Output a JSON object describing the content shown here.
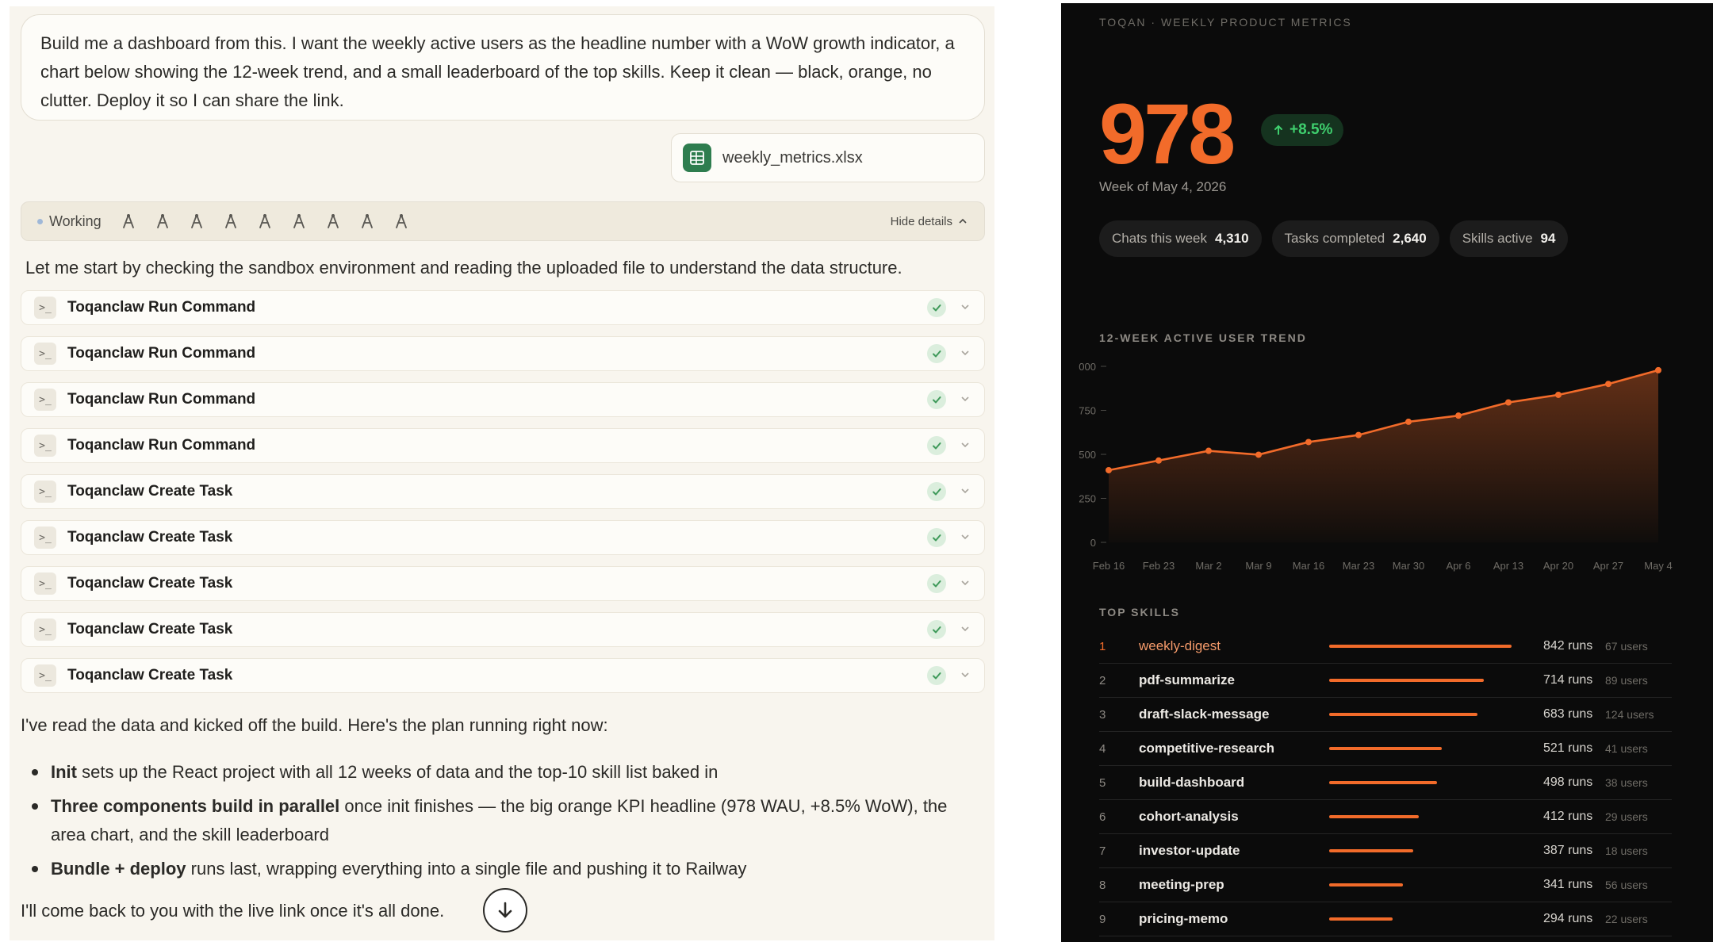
{
  "chat": {
    "prompt": "Build me a dashboard from this. I want the weekly active users as the headline number with a WoW growth indicator, a chart below showing the 12-week trend, and a small leaderboard of the top skills. Keep it clean — black, orange, no clutter. Deploy it so I can share the link.",
    "attachment": {
      "filename": "weekly_metrics.xlsx",
      "icon": "spreadsheet-icon"
    },
    "working": {
      "status": "Working",
      "hide_details": "Hide details",
      "tool_icon_count": 9
    },
    "intro": "Let me start by checking the sandbox environment and reading the uploaded file to understand the data structure.",
    "tool_calls": [
      {
        "label": "Toqanclaw Run Command",
        "status": "done"
      },
      {
        "label": "Toqanclaw Run Command",
        "status": "done"
      },
      {
        "label": "Toqanclaw Run Command",
        "status": "done"
      },
      {
        "label": "Toqanclaw Run Command",
        "status": "done"
      },
      {
        "label": "Toqanclaw Create Task",
        "status": "done"
      },
      {
        "label": "Toqanclaw Create Task",
        "status": "done"
      },
      {
        "label": "Toqanclaw Create Task",
        "status": "done"
      },
      {
        "label": "Toqanclaw Create Task",
        "status": "done"
      },
      {
        "label": "Toqanclaw Create Task",
        "status": "done"
      }
    ],
    "plan_intro": "I've read the data and kicked off the build. Here's the plan running right now:",
    "plan": [
      {
        "bold": "Init",
        "rest": " sets up the React project with all 12 weeks of data and the top-10 skill list baked in"
      },
      {
        "bold": "Three components build in parallel",
        "rest": " once init finishes — the big orange KPI headline (978 WAU, +8.5% WoW), the area chart, and the skill leaderboard"
      },
      {
        "bold": "Bundle + deploy",
        "rest": " runs last, wrapping everything into a single file and pushing it to Railway"
      }
    ],
    "closing": "I'll come back to you with the live link once it's all done."
  },
  "dashboard": {
    "brand": "TOQAN · WEEKLY PRODUCT METRICS",
    "kpi": "978",
    "growth": "+8.5%",
    "week": "Week of May 4, 2026",
    "stats": [
      {
        "label": "Chats this week",
        "value": "4,310"
      },
      {
        "label": "Tasks completed",
        "value": "2,640"
      },
      {
        "label": "Skills active",
        "value": "94"
      }
    ],
    "trend_title": "12-WEEK ACTIVE USER TREND",
    "skills_title": "TOP SKILLS",
    "colors": {
      "accent": "#f26b2a",
      "background": "#0b0b0b",
      "growth": "#3fcf6e"
    },
    "skills": [
      {
        "rank": "1",
        "name": "weekly-digest",
        "runs_label": "842 runs",
        "users_label": "67 users",
        "runs": 842
      },
      {
        "rank": "2",
        "name": "pdf-summarize",
        "runs_label": "714 runs",
        "users_label": "89 users",
        "runs": 714
      },
      {
        "rank": "3",
        "name": "draft-slack-message",
        "runs_label": "683 runs",
        "users_label": "124 users",
        "runs": 683
      },
      {
        "rank": "4",
        "name": "competitive-research",
        "runs_label": "521 runs",
        "users_label": "41 users",
        "runs": 521
      },
      {
        "rank": "5",
        "name": "build-dashboard",
        "runs_label": "498 runs",
        "users_label": "38 users",
        "runs": 498
      },
      {
        "rank": "6",
        "name": "cohort-analysis",
        "runs_label": "412 runs",
        "users_label": "29 users",
        "runs": 412
      },
      {
        "rank": "7",
        "name": "investor-update",
        "runs_label": "387 runs",
        "users_label": "18 users",
        "runs": 387
      },
      {
        "rank": "8",
        "name": "meeting-prep",
        "runs_label": "341 runs",
        "users_label": "56 users",
        "runs": 341
      },
      {
        "rank": "9",
        "name": "pricing-memo",
        "runs_label": "294 runs",
        "users_label": "22 users",
        "runs": 294
      }
    ]
  },
  "chart_data": {
    "type": "area",
    "title": "12-WEEK ACTIVE USER TREND",
    "categories": [
      "Feb 16",
      "Feb 23",
      "Mar 2",
      "Mar 9",
      "Mar 16",
      "Mar 23",
      "Mar 30",
      "Apr 6",
      "Apr 13",
      "Apr 20",
      "Apr 27",
      "May 4"
    ],
    "series": [
      {
        "values": [
          410,
          465,
          520,
          498,
          570,
          610,
          685,
          720,
          795,
          838,
          900,
          978
        ]
      }
    ],
    "y_ticks": [
      "000",
      "750",
      "500",
      "250",
      "0"
    ],
    "ylim": [
      0,
      1000
    ],
    "grid": false
  }
}
